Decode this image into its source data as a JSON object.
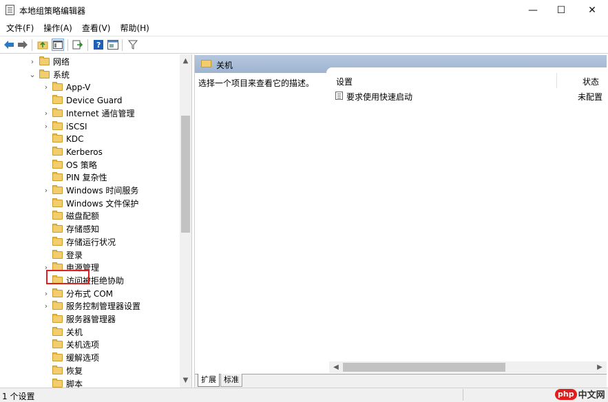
{
  "window": {
    "title": "本地组策略编辑器",
    "minimize": "—",
    "maximize": "☐",
    "close": "✕"
  },
  "menu": [
    "文件(F)",
    "操作(A)",
    "查看(V)",
    "帮助(H)"
  ],
  "toolbar": {
    "icons": [
      "back-arrow-icon",
      "forward-arrow-icon",
      "up-folder-icon",
      "show-hide-tree-icon",
      "export-list-icon",
      "help-icon",
      "properties-icon",
      "filter-icon"
    ]
  },
  "tree": {
    "items": [
      {
        "label": "网络",
        "indent": 1,
        "expander": "›"
      },
      {
        "label": "系统",
        "indent": 1,
        "expander": "⌄"
      },
      {
        "label": "App-V",
        "indent": 2,
        "expander": "›"
      },
      {
        "label": "Device Guard",
        "indent": 2,
        "expander": ""
      },
      {
        "label": "Internet 通信管理",
        "indent": 2,
        "expander": "›"
      },
      {
        "label": "iSCSI",
        "indent": 2,
        "expander": "›"
      },
      {
        "label": "KDC",
        "indent": 2,
        "expander": ""
      },
      {
        "label": "Kerberos",
        "indent": 2,
        "expander": ""
      },
      {
        "label": "OS 策略",
        "indent": 2,
        "expander": ""
      },
      {
        "label": "PIN 复杂性",
        "indent": 2,
        "expander": ""
      },
      {
        "label": "Windows 时间服务",
        "indent": 2,
        "expander": "›"
      },
      {
        "label": "Windows 文件保护",
        "indent": 2,
        "expander": ""
      },
      {
        "label": "磁盘配额",
        "indent": 2,
        "expander": ""
      },
      {
        "label": "存储感知",
        "indent": 2,
        "expander": ""
      },
      {
        "label": "存储运行状况",
        "indent": 2,
        "expander": ""
      },
      {
        "label": "登录",
        "indent": 2,
        "expander": ""
      },
      {
        "label": "电源管理",
        "indent": 2,
        "expander": "›"
      },
      {
        "label": "访问被拒绝协助",
        "indent": 2,
        "expander": ""
      },
      {
        "label": "分布式 COM",
        "indent": 2,
        "expander": "›"
      },
      {
        "label": "服务控制管理器设置",
        "indent": 2,
        "expander": "›"
      },
      {
        "label": "服务器管理器",
        "indent": 2,
        "expander": ""
      },
      {
        "label": "关机",
        "indent": 2,
        "expander": "",
        "selected": true
      },
      {
        "label": "关机选项",
        "indent": 2,
        "expander": ""
      },
      {
        "label": "缓解选项",
        "indent": 2,
        "expander": ""
      },
      {
        "label": "恢复",
        "indent": 2,
        "expander": ""
      },
      {
        "label": "脚本",
        "indent": 2,
        "expander": ""
      }
    ]
  },
  "right": {
    "header_title": "关机",
    "description": "选择一个项目来查看它的描述。",
    "columns": {
      "setting": "设置",
      "state": "状态"
    },
    "rows": [
      {
        "setting": "要求使用快速启动",
        "state": "未配置"
      }
    ],
    "tabs": [
      "扩展",
      "标准"
    ]
  },
  "statusbar": {
    "text": "1 个设置"
  },
  "watermark": {
    "logo": "php",
    "text": "中文网"
  },
  "colors": {
    "header_gradient_top": "#b5c7de",
    "header_gradient_bottom": "#9fb4d0",
    "highlight_box": "#e02020",
    "folder": "#f2cd6e"
  }
}
